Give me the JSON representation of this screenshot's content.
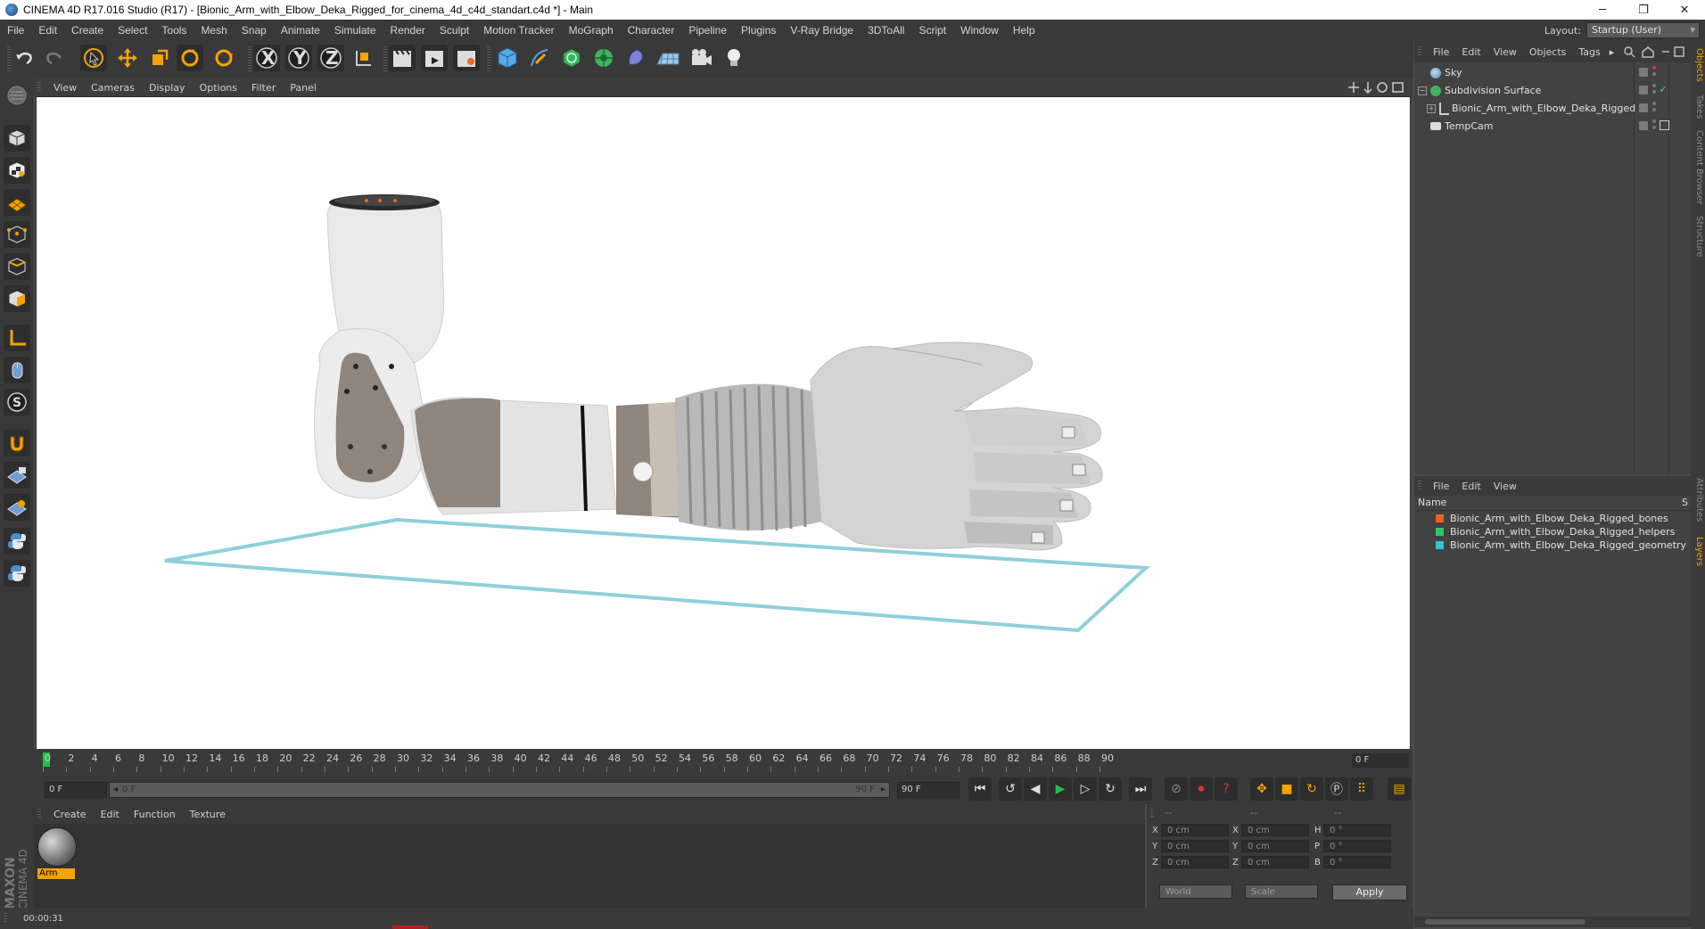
{
  "window": {
    "title": "CINEMA 4D R17.016 Studio (R17) - [Bionic_Arm_with_Elbow_Deka_Rigged_for_cinema_4d_c4d_standart.c4d *] - Main",
    "minimize": "─",
    "maximize": "❐",
    "close": "✕"
  },
  "menubar": {
    "items": [
      "File",
      "Edit",
      "Create",
      "Select",
      "Tools",
      "Mesh",
      "Snap",
      "Animate",
      "Simulate",
      "Render",
      "Sculpt",
      "Motion Tracker",
      "MoGraph",
      "Character",
      "Pipeline",
      "Plugins",
      "V-Ray Bridge",
      "3DToAll",
      "Script",
      "Window",
      "Help"
    ],
    "layout_label": "Layout:",
    "layout_value": "Startup (User)"
  },
  "toolbar": {
    "x_label": "X",
    "y_label": "Y",
    "z_label": "Z"
  },
  "viewport": {
    "menu": [
      "View",
      "Cameras",
      "Display",
      "Options",
      "Filter",
      "Panel"
    ]
  },
  "timeline": {
    "ticks": [
      "0",
      "2",
      "4",
      "6",
      "8",
      "10",
      "12",
      "14",
      "16",
      "18",
      "20",
      "22",
      "24",
      "26",
      "28",
      "30",
      "32",
      "34",
      "36",
      "38",
      "40",
      "42",
      "44",
      "46",
      "48",
      "50",
      "52",
      "54",
      "56",
      "58",
      "60",
      "62",
      "64",
      "66",
      "68",
      "70",
      "72",
      "74",
      "76",
      "78",
      "80",
      "82",
      "84",
      "86",
      "88",
      "90"
    ],
    "current_frame": "0 F"
  },
  "transport": {
    "start_field": "0 F",
    "range_start": "0 F",
    "range_end": "90 F",
    "end_field": "90 F"
  },
  "material_manager": {
    "menu": [
      "Create",
      "Edit",
      "Function",
      "Texture"
    ],
    "materials": [
      {
        "name": "Arm"
      }
    ]
  },
  "coordinates": {
    "head": [
      "--",
      "--",
      "--"
    ],
    "rows": [
      {
        "a": "X",
        "av": "0 cm",
        "b": "X",
        "bv": "0 cm",
        "c": "H",
        "cv": "0 °"
      },
      {
        "a": "Y",
        "av": "0 cm",
        "b": "Y",
        "bv": "0 cm",
        "c": "P",
        "cv": "0 °"
      },
      {
        "a": "Z",
        "av": "0 cm",
        "b": "Z",
        "bv": "0 cm",
        "c": "B",
        "cv": "0 °"
      }
    ],
    "mode": "World",
    "size_mode": "Scale",
    "apply": "Apply"
  },
  "status": {
    "time": "00:00:31"
  },
  "object_manager": {
    "menu": [
      "File",
      "Edit",
      "View",
      "Objects",
      "Tags"
    ],
    "objects": [
      {
        "name": "Sky"
      },
      {
        "name": "Subdivision Surface"
      },
      {
        "name": "Bionic_Arm_with_Elbow_Deka_Rigged"
      },
      {
        "name": "TempCam"
      }
    ]
  },
  "layer_manager": {
    "menu": [
      "File",
      "Edit",
      "View"
    ],
    "col_name": "Name",
    "col_s": "S",
    "layers": [
      {
        "name": "Bionic_Arm_with_Elbow_Deka_Rigged_bones",
        "color": "#e8641e"
      },
      {
        "name": "Bionic_Arm_with_Elbow_Deka_Rigged_helpers",
        "color": "#2fc46a"
      },
      {
        "name": "Bionic_Arm_with_Elbow_Deka_Rigged_geometry",
        "color": "#2fc4d6"
      }
    ]
  },
  "side_tabs": [
    "Objects",
    "Takes",
    "Content Browser",
    "Structure",
    "Attributes",
    "Layers"
  ],
  "colors": {
    "accent": "#f5a300",
    "selection": "#6f9ed3",
    "plane": "#8fcfdc"
  }
}
